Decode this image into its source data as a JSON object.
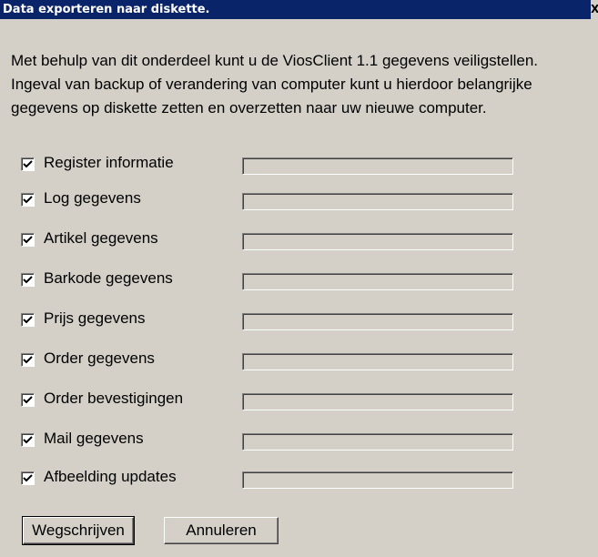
{
  "window": {
    "title": "Data exporteren naar diskette.",
    "close_glyph": "X"
  },
  "description": {
    "lines": [
      "Met behulp van dit onderdeel kunt u de ViosClient 1.1 gegevens veiligstellen.",
      "Ingeval van backup of verandering van computer kunt u hierdoor belangrijke",
      "gegevens op diskette zetten en overzetten naar uw nieuwe computer."
    ]
  },
  "items": [
    {
      "label": "Register informatie",
      "checked": true,
      "progress": 0
    },
    {
      "label": "Log gegevens",
      "checked": true,
      "progress": 0
    },
    {
      "label": "Artikel gegevens",
      "checked": true,
      "progress": 0
    },
    {
      "label": "Barkode gegevens",
      "checked": true,
      "progress": 0
    },
    {
      "label": "Prijs gegevens",
      "checked": true,
      "progress": 0
    },
    {
      "label": "Order gegevens",
      "checked": true,
      "progress": 0
    },
    {
      "label": "Order bevestigingen",
      "checked": true,
      "progress": 0
    },
    {
      "label": "Mail gegevens",
      "checked": true,
      "progress": 0
    },
    {
      "label": "Afbeelding updates",
      "checked": true,
      "progress": 0
    }
  ],
  "buttons": {
    "write_label": "Wegschrijven",
    "cancel_label": "Annuleren"
  },
  "colors": {
    "titlebar": "#0a246a",
    "face": "#d4d0c8"
  }
}
